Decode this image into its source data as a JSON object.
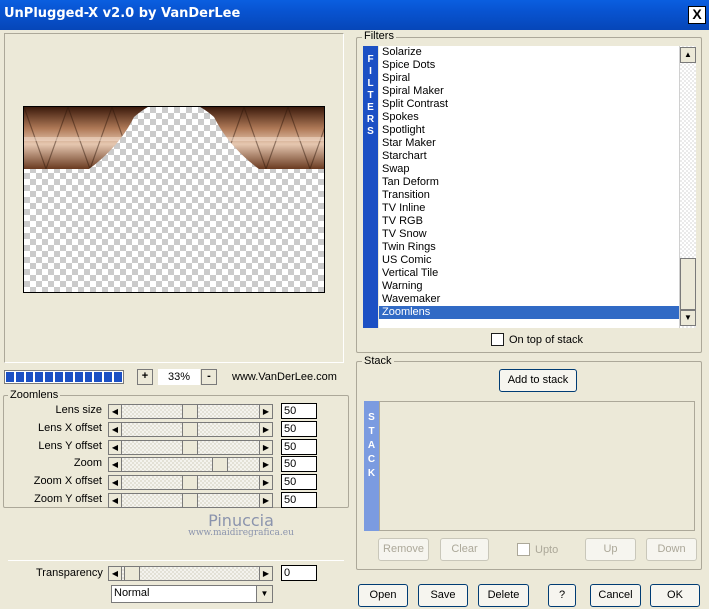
{
  "window": {
    "title": "UnPlugged-X v2.0 by VanDerLee",
    "close_label": "X"
  },
  "preview": {
    "zoom_minus": "-",
    "zoom_plus": "+",
    "zoom_value": "33%",
    "site": "www.VanDerLee.com"
  },
  "zoomlens": {
    "group_label": "Zoomlens",
    "params": [
      {
        "label": "Lens size",
        "value": "50"
      },
      {
        "label": "Lens X offset",
        "value": "50"
      },
      {
        "label": "Lens Y offset",
        "value": "50"
      },
      {
        "label": "Zoom",
        "value": "50"
      },
      {
        "label": "Zoom X offset",
        "value": "50"
      },
      {
        "label": "Zoom Y offset",
        "value": "50"
      }
    ]
  },
  "watermark": {
    "name": "Pinuccia",
    "url": "www.maidiregrafica.eu"
  },
  "transparency": {
    "label": "Transparency",
    "value": "0",
    "mode": "Normal"
  },
  "filters": {
    "group_label": "Filters",
    "side_letters": [
      "F",
      "I",
      "L",
      "T",
      "E",
      "R",
      "S"
    ],
    "items": [
      "Solarize",
      "Spice Dots",
      "Spiral",
      "Spiral Maker",
      "Split Contrast",
      "Spokes",
      "Spotlight",
      "Star Maker",
      "Starchart",
      "Swap",
      "Tan Deform",
      "Transition",
      "TV Inline",
      "TV RGB",
      "TV Snow",
      "Twin Rings",
      "US Comic",
      "Vertical Tile",
      "Warning",
      "Wavemaker",
      "Zoomlens"
    ],
    "selected": "Zoomlens",
    "on_top_label": "On top of stack"
  },
  "stack": {
    "group_label": "Stack",
    "add_label": "Add to stack",
    "side_letters": [
      "S",
      "T",
      "A",
      "C",
      "K"
    ],
    "remove_label": "Remove",
    "clear_label": "Clear",
    "upto_label": "Upto",
    "up_label": "Up",
    "down_label": "Down"
  },
  "footer": {
    "open": "Open",
    "save": "Save",
    "delete": "Delete",
    "help": "?",
    "cancel": "Cancel",
    "ok": "OK"
  },
  "icons": {
    "close": "close-icon",
    "arrow_left": "arrow-left-icon",
    "arrow_right": "arrow-right-icon",
    "arrow_up": "arrow-up-icon",
    "arrow_down": "arrow-down-icon"
  }
}
